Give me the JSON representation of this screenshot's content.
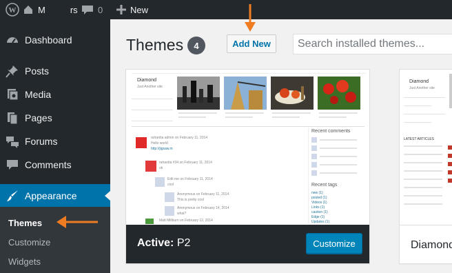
{
  "admin_bar": {
    "site_name": "M",
    "site_name_tail": "rs",
    "comments_count": "0",
    "new_label": "New"
  },
  "sidebar": {
    "items": [
      {
        "label": "Dashboard",
        "icon": "dashboard-icon"
      },
      {
        "label": "Posts",
        "icon": "pin-icon"
      },
      {
        "label": "Media",
        "icon": "media-icon"
      },
      {
        "label": "Pages",
        "icon": "pages-icon"
      },
      {
        "label": "Forums",
        "icon": "forums-icon"
      },
      {
        "label": "Comments",
        "icon": "comments-icon"
      },
      {
        "label": "Appearance",
        "icon": "brush-icon"
      }
    ],
    "submenu": [
      {
        "label": "Themes"
      },
      {
        "label": "Customize"
      },
      {
        "label": "Widgets"
      }
    ]
  },
  "page": {
    "title": "Themes",
    "count": "4",
    "add_new": "Add New",
    "search_placeholder": "Search installed themes..."
  },
  "themes": [
    {
      "active_prefix": "Active:",
      "name": "P2",
      "customize": "Customize",
      "preview": {
        "site_title": "Diamond",
        "site_desc": "Just Another site",
        "recent_comments_title": "Recent comments",
        "recent_tags_title": "Recent tags",
        "tags": [
          "new (1)",
          "posted (1)",
          "Videos (1)",
          "Links (1)",
          "caution (1)",
          "Edge (1)",
          "Updates (1)"
        ],
        "comment_lines": [
          "rahardia admin on February 11, 2014",
          "Hello world",
          "http://jigsaw.m",
          "rahardia #34 on February 11, 2014",
          "ok",
          "Edit me on February 11, 2014",
          "cool",
          "Anonymous on February 11, 2014",
          "This is pretty cool",
          "Anonymous on February 14, 2014",
          "what?",
          "Matt Millburn on February 12, 2014"
        ]
      }
    },
    {
      "name": "Diamond",
      "preview": {
        "site_title": "Diamond",
        "site_desc": "Just Another site",
        "latest_title": "LATEST ARTICLES"
      }
    }
  ],
  "colors": {
    "accent": "#0073aa",
    "arrow": "#f07c22",
    "admin_bg": "#23282d"
  }
}
